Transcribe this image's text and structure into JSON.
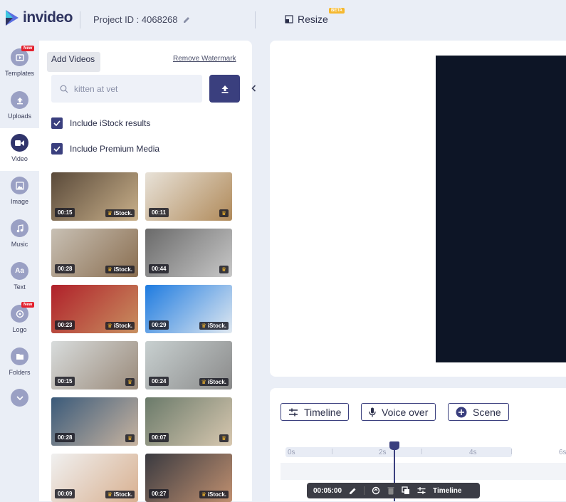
{
  "header": {
    "logo_text": "invideo",
    "project_label": "Project ID : 4068268",
    "resize_label": "Resize",
    "beta_badge": "BETA"
  },
  "rail": [
    {
      "label": "Templates",
      "icon": "templates-icon",
      "badge": "New"
    },
    {
      "label": "Uploads",
      "icon": "upload-icon"
    },
    {
      "label": "Video",
      "icon": "video-camera-icon",
      "active": true
    },
    {
      "label": "Image",
      "icon": "image-icon"
    },
    {
      "label": "Music",
      "icon": "music-note-icon"
    },
    {
      "label": "Text",
      "icon": "text-aa-icon"
    },
    {
      "label": "Logo",
      "icon": "logo-icon",
      "badge": "New"
    },
    {
      "label": "Folders",
      "icon": "folder-icon"
    },
    {
      "label": "",
      "icon": "chevron-down-icon"
    }
  ],
  "panel": {
    "tooltip": "Add Videos",
    "remove_watermark": "Remove Watermark",
    "search_value": "kitten at vet",
    "include_istock": "Include iStock results",
    "include_premium": "Include Premium Media"
  },
  "thumbnails": [
    {
      "duration": "00:15",
      "istock": true,
      "colors": [
        "#5a4a3a",
        "#c9b08a"
      ]
    },
    {
      "duration": "00:11",
      "istock": false,
      "colors": [
        "#e8e2d8",
        "#b08a5a"
      ]
    },
    {
      "duration": "00:28",
      "istock": true,
      "colors": [
        "#c8c0b4",
        "#8a6e50"
      ]
    },
    {
      "duration": "00:44",
      "istock": false,
      "colors": [
        "#6a6a6a",
        "#c8c8c8"
      ]
    },
    {
      "duration": "00:23",
      "istock": true,
      "colors": [
        "#b0202a",
        "#c89060"
      ]
    },
    {
      "duration": "00:29",
      "istock": true,
      "colors": [
        "#1e7be0",
        "#e0e8f0"
      ]
    },
    {
      "duration": "00:15",
      "istock": false,
      "colors": [
        "#d8dcdc",
        "#9a8a7a"
      ]
    },
    {
      "duration": "00:24",
      "istock": true,
      "colors": [
        "#c8d0d0",
        "#8a8a8a"
      ]
    },
    {
      "duration": "00:28",
      "istock": false,
      "colors": [
        "#3a5a7a",
        "#c8b4a0"
      ]
    },
    {
      "duration": "00:07",
      "istock": false,
      "colors": [
        "#6a7a6a",
        "#d8c8b0"
      ]
    },
    {
      "duration": "00:09",
      "istock": true,
      "colors": [
        "#f0f0f0",
        "#d8b090"
      ]
    },
    {
      "duration": "00:27",
      "istock": true,
      "colors": [
        "#3a3a40",
        "#c09070"
      ]
    }
  ],
  "istock_label": "iStock.",
  "timeline": {
    "timeline_btn": "Timeline",
    "voiceover_btn": "Voice over",
    "scene_btn": "Scene",
    "ticks": [
      "0s",
      "2s",
      "4s",
      "6s"
    ],
    "scene_duration": "00:05:00",
    "scene_timeline_label": "Timeline"
  }
}
